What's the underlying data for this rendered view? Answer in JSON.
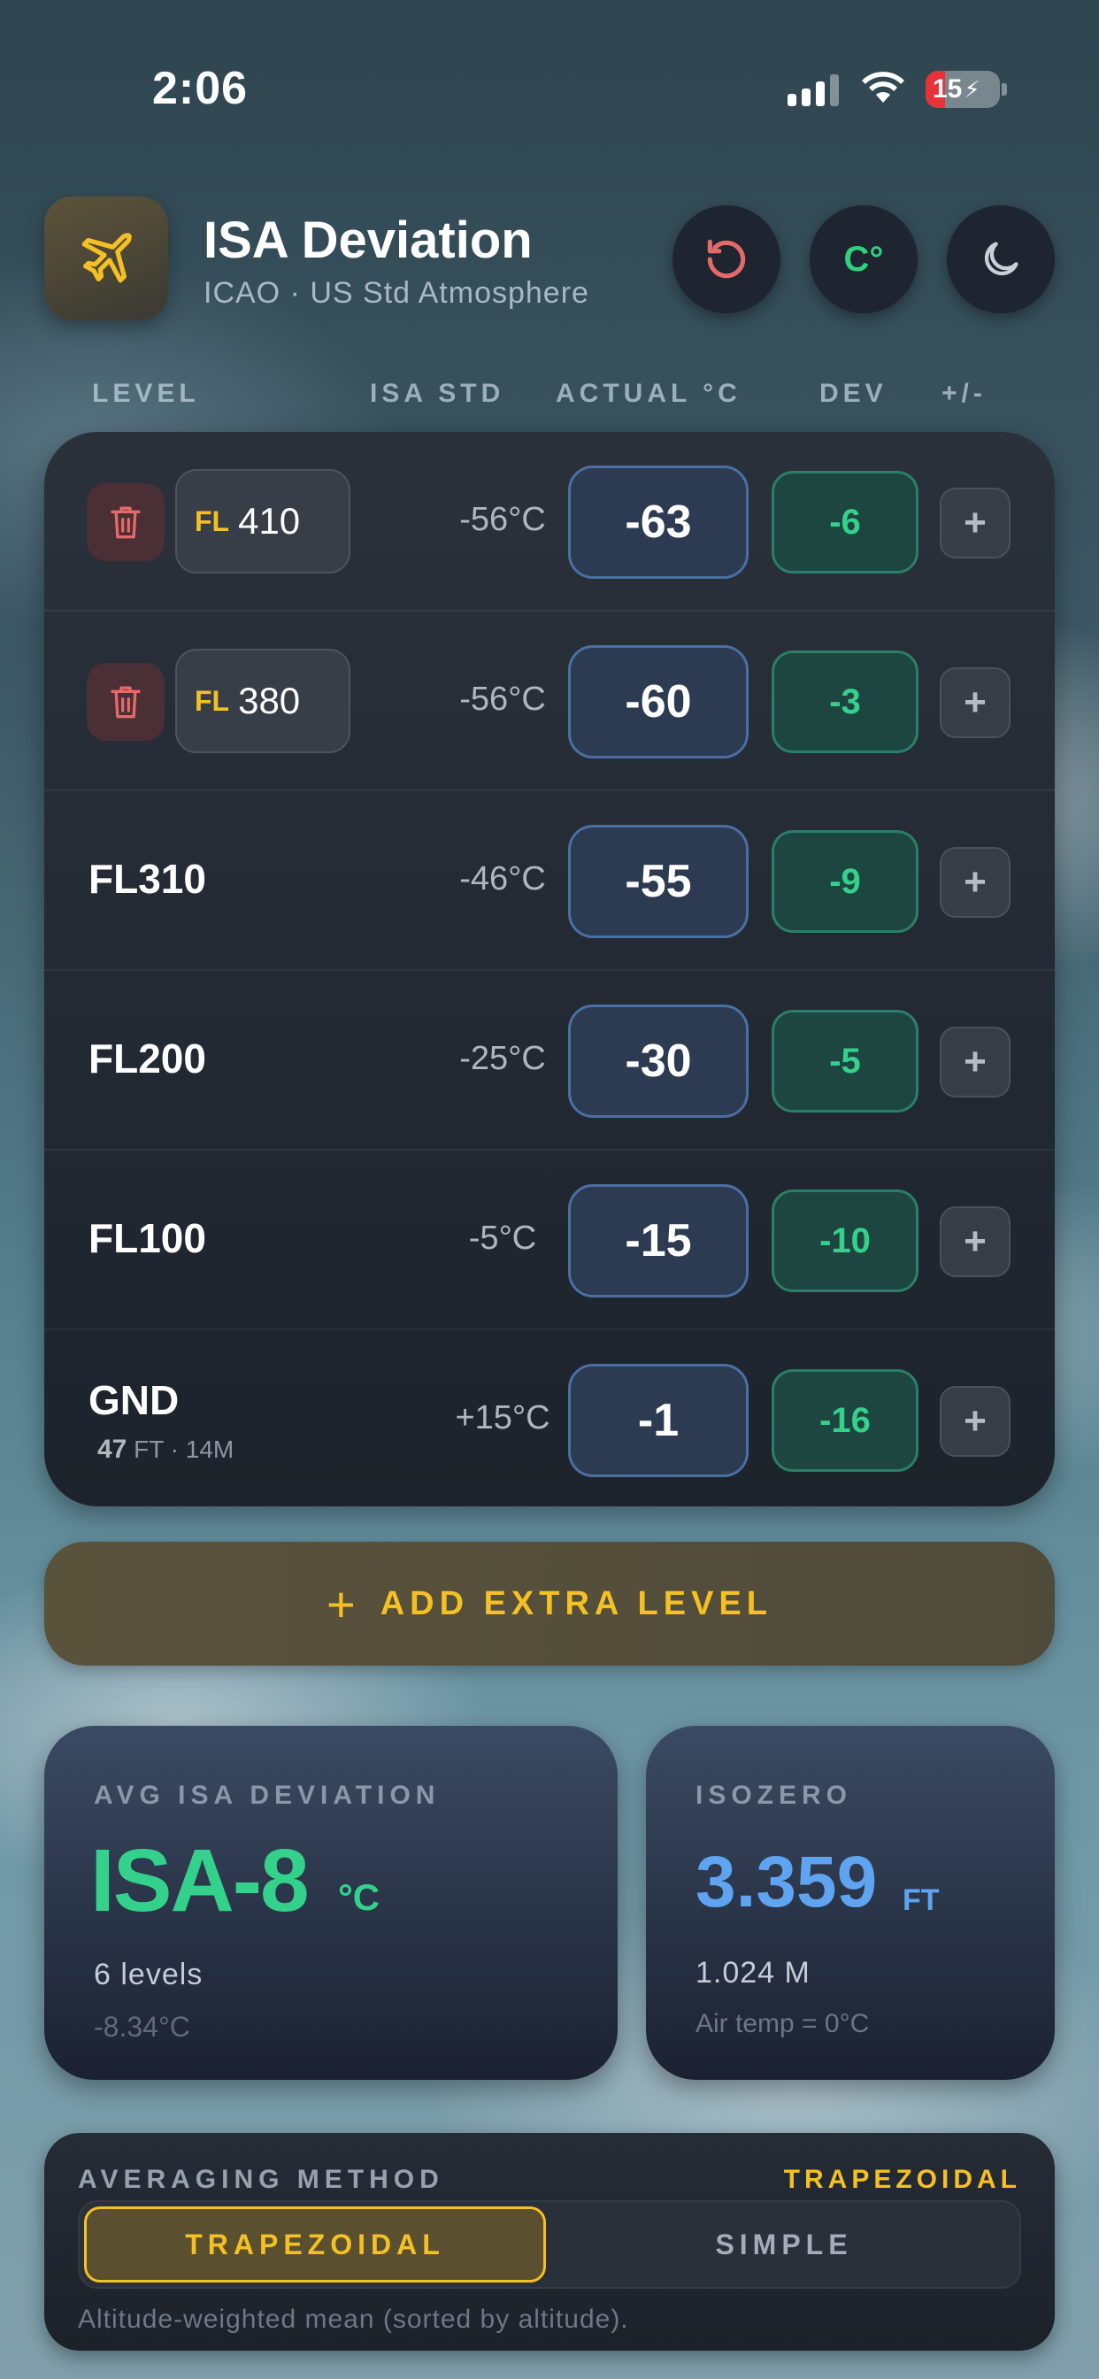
{
  "status_bar": {
    "time": "2:06",
    "battery": "15"
  },
  "header": {
    "title": "ISA Deviation",
    "subtitle": "ICAO · US Std Atmosphere",
    "unit_button": "C°"
  },
  "columns": [
    "LEVEL",
    "ISA STD",
    "ACTUAL °C",
    "DEV",
    "+/-"
  ],
  "rows": [
    {
      "editable": true,
      "prefix": "FL",
      "level": "410",
      "isa": "-56°C",
      "actual": "-63",
      "dev": "-6"
    },
    {
      "editable": true,
      "prefix": "FL",
      "level": "380",
      "isa": "-56°C",
      "actual": "-60",
      "dev": "-3"
    },
    {
      "editable": false,
      "level": "FL310",
      "isa": "-46°C",
      "actual": "-55",
      "dev": "-9"
    },
    {
      "editable": false,
      "level": "FL200",
      "isa": "-25°C",
      "actual": "-30",
      "dev": "-5"
    },
    {
      "editable": false,
      "level": "FL100",
      "isa": "-5°C",
      "actual": "-15",
      "dev": "-10"
    },
    {
      "editable": false,
      "level": "GND",
      "sub_value": "47",
      "sub_unit": "FT",
      "sub_extra": "· 14M",
      "isa": "+15°C",
      "actual": "-1",
      "dev": "-16"
    }
  ],
  "plus_label": "+",
  "add_level": {
    "icon": "+",
    "label": "ADD EXTRA LEVEL"
  },
  "avg_card": {
    "label": "AVG ISA DEVIATION",
    "value": "ISA-8",
    "unit": "°C",
    "line1": "6 levels",
    "line2": "-8.34°C"
  },
  "iso_card": {
    "label": "ISOZERO",
    "value": "3.359",
    "unit": "FT",
    "line1": "1.024 M",
    "line2": "Air temp = 0°C"
  },
  "method": {
    "label": "AVERAGING METHOD",
    "current": "TRAPEZOIDAL",
    "options": [
      "TRAPEZOIDAL",
      "SIMPLE"
    ],
    "selected": 0,
    "description": "Altitude-weighted mean (sorted by altitude)."
  },
  "colors": {
    "accent_yellow": "#f5c024",
    "dev_green": "#33d18c",
    "iso_blue": "#5ea4f0",
    "trash_red": "#e46a6a"
  }
}
